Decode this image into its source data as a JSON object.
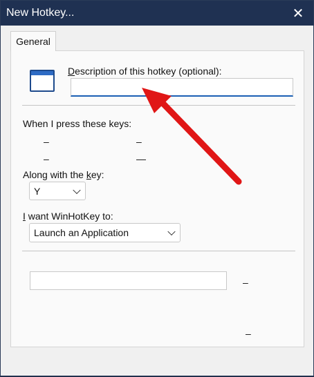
{
  "window": {
    "title": "New Hotkey...",
    "close_symbol": "✕"
  },
  "tabs": [
    {
      "label": "General",
      "selected": true
    }
  ],
  "description": {
    "label_prefix": "D",
    "label_rest": "escription of this hotkey (optional):",
    "value": ""
  },
  "keys_section": {
    "label": "When I press these keys:",
    "options": [
      "–",
      "–",
      "–",
      "—"
    ]
  },
  "key_section": {
    "label_prefix": "Along with the ",
    "label_underlined": "k",
    "label_suffix": "ey:",
    "selected": "Y"
  },
  "action_section": {
    "label_prefix": "",
    "label_underlined": "I",
    "label_suffix": " want WinHotKey to:",
    "selected": "Launch an Application"
  },
  "bottom": {
    "path_value": "",
    "dash_right_1": "–",
    "dash_right_2": "–"
  },
  "annotation": {
    "arrow_color": "#e01616"
  }
}
